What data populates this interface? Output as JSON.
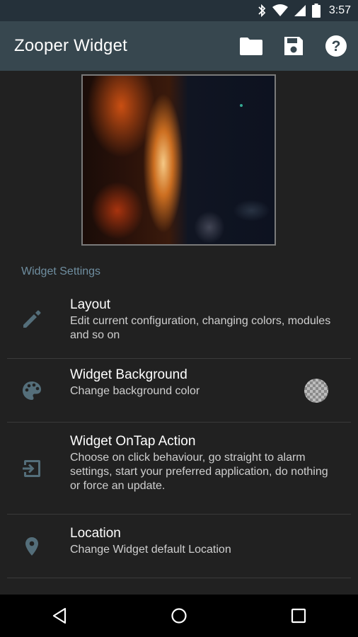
{
  "status_bar": {
    "time": "3:57",
    "icons": [
      "bluetooth-icon",
      "wifi-icon",
      "signal-icon",
      "battery-icon"
    ]
  },
  "app_bar": {
    "title": "Zooper Widget",
    "actions": [
      "folder-icon",
      "save-icon",
      "help-icon"
    ]
  },
  "preview": {
    "description_icon": "widget-preview-image"
  },
  "section": {
    "header": "Widget Settings"
  },
  "settings": [
    {
      "icon": "pencil-icon",
      "title": "Layout",
      "subtitle": "Edit current configuration, changing colors, modules and so on"
    },
    {
      "icon": "palette-icon",
      "title": "Widget Background",
      "subtitle": "Change background color"
    },
    {
      "icon": "exit-to-app-icon",
      "title": "Widget OnTap Action",
      "subtitle": "Choose on click behaviour, go straight to alarm settings, start your preferred application, do nothing or force an update."
    },
    {
      "icon": "location-pin-icon",
      "title": "Location",
      "subtitle": "Change Widget default Location"
    }
  ],
  "nav_bar": {
    "buttons": [
      "back-icon",
      "home-icon",
      "recents-icon"
    ]
  },
  "colors": {
    "status_bar": "#25313a",
    "app_bar": "#37474f",
    "background": "#212121",
    "section_header": "#6f8ea0",
    "icon_tint": "#546e7a"
  }
}
